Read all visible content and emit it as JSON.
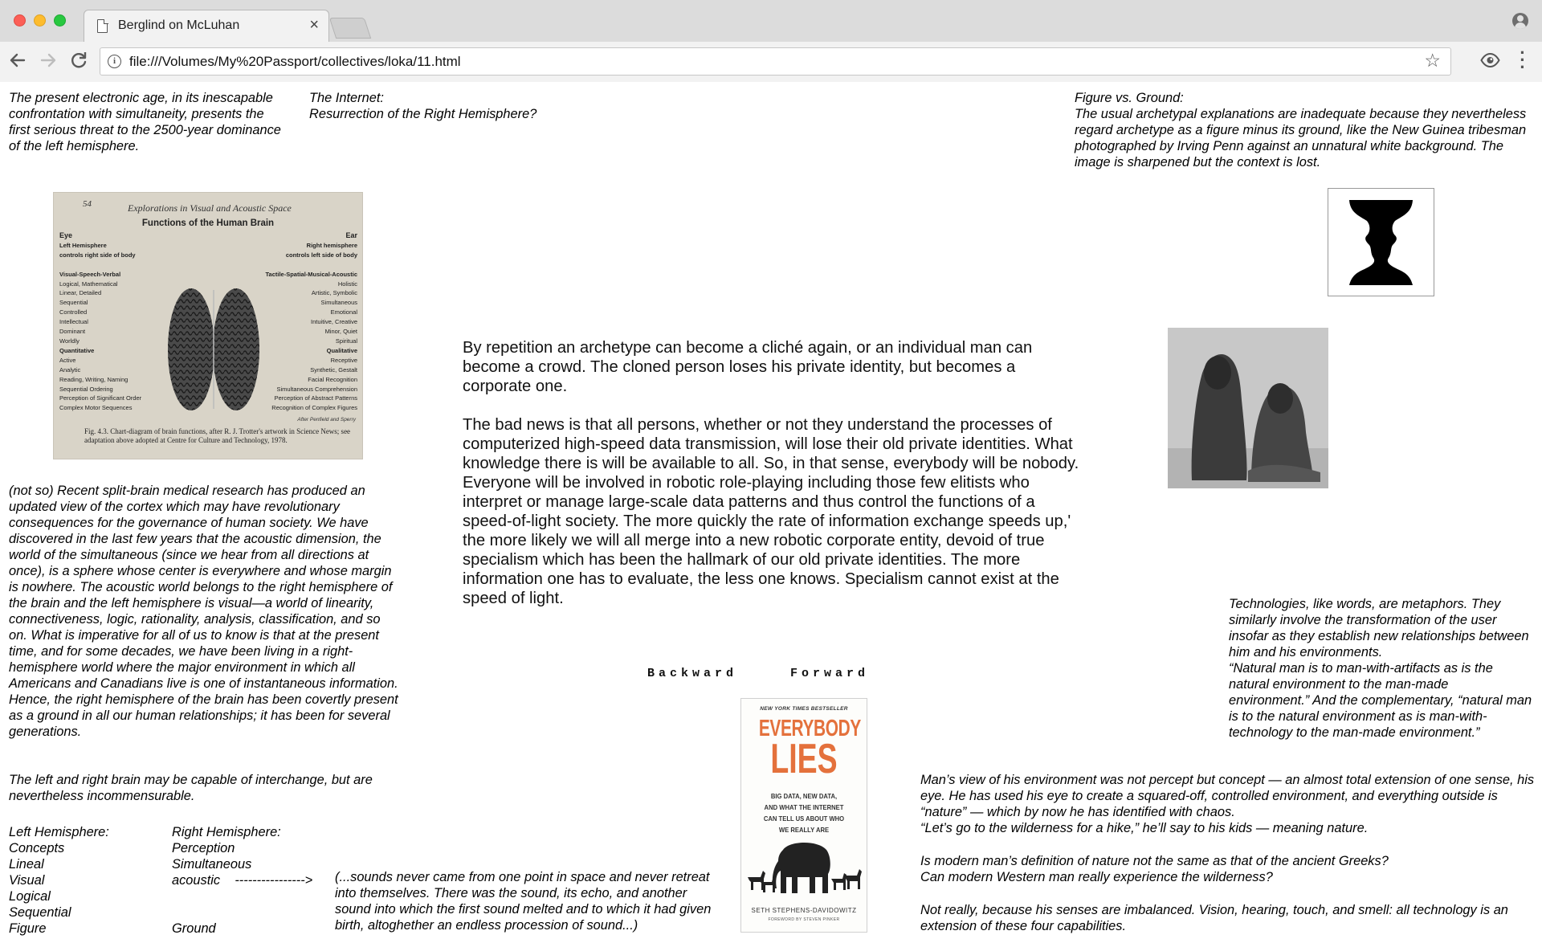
{
  "browser": {
    "tab_title": "Berglind on McLuhan",
    "tab_close": "×",
    "url": "file:///Volumes/My%20Passport/collectives/loka/11.html",
    "icons": [
      "page-icon",
      "close-icon",
      "profile-icon",
      "back-arrow-icon",
      "forward-arrow-icon",
      "reload-icon",
      "info-icon",
      "star-icon",
      "eye-icon",
      "menu-dots-icon"
    ]
  },
  "page": {
    "top_left_quote": "The present electronic age, in its inescapable confrontation with simultaneity, presents the first serious threat to the 2500-year dominance of the left hemisphere.",
    "top_center_title": "The Internet:\nResurrection of the Right Hemisphere?",
    "top_right_title": "Figure vs. Ground:",
    "top_right_text": "The usual archetypal explanations are inadequate because they nevertheless regard archetype as a figure minus its ground, like the New Guinea tribesman photographed by Irving Penn against an unnatural white background. The image is sharpened but the context is lost.",
    "brain_image": {
      "page_number": "54",
      "running_head": "Explorations in Visual and Acoustic Space",
      "title": "Functions of the Human Brain",
      "left_column": [
        "Eye",
        "Left Hemisphere",
        "controls right side of body",
        "",
        "Visual-Speech-Verbal",
        "Logical, Mathematical",
        "Linear, Detailed",
        "Sequential",
        "Controlled",
        "Intellectual",
        "Dominant",
        "Worldly",
        "Quantitative",
        "Active",
        "Analytic",
        "Reading, Writing, Naming",
        "Sequential Ordering",
        "Perception of Significant Order",
        "Complex Motor Sequences"
      ],
      "right_column": [
        "Ear",
        "Right hemisphere",
        "controls left side of body",
        "",
        "Tactile-Spatial-Musical-Acoustic",
        "Holistic",
        "Artistic, Symbolic",
        "Simultaneous",
        "Emotional",
        "Intuitive, Creative",
        "Minor, Quiet",
        "Spiritual",
        "Qualitative",
        "Receptive",
        "Synthetic, Gestalt",
        "Facial Recognition",
        "Simultaneous Comprehension",
        "Perception of Abstract Patterns",
        "Recognition of Complex Figures"
      ],
      "credit": "After Penfield and Sperry",
      "caption": "Fig. 4.3. Chart-diagram of brain functions, after R. J. Trotter's artwork in Science News; see adaptation above adopted at Centre for Culture and Technology, 1978."
    },
    "main_paragraph_1": "By repetition an archetype can become a cliché again, or an individual man can become a crowd. The cloned person loses his private identity, but becomes a corporate one.",
    "main_paragraph_2": "The bad news is that all persons, whether or not they understand the processes of computerized high-speed data transmission, will lose their old private identities. What knowledge there is will be available to all. So, in that sense, everybody will be nobody. Everyone will be involved in robotic role-playing including those few elitists who interpret or manage large-scale data patterns and thus control the functions of a speed-of-light society. The more quickly the rate of information exchange speeds up,' the more likely we will all merge into a new robotic corporate entity, devoid of true specialism which has been the hallmark of our old private identities. The more information one has to evaluate, the less one knows. Specialism cannot exist at the speed of light.",
    "split_brain_text": "(not so) Recent split-brain medical research has produced an updated view of the cortex which may have revolutionary consequences for the governance of human society. We have discovered in the last few years that the acoustic dimension, the world of the simultaneous (since we hear from all directions at once), is a sphere whose center is everywhere and whose margin is nowhere. The acoustic world belongs to the right hemisphere of the brain and the left hemisphere is visual—a world of linearity, connectiveness, logic, rationality, analysis, classification, and so on. What is imperative for all of us to know is that at the present time, and for some decades, we have been living in a right-hemisphere world where the major environment in which all Americans and Canadians live is one of instantaneous information. Hence, the right hemisphere of the brain has been covertly present as a ground in all our human relationships; it has been for several generations.",
    "interchange_text": "The left and right brain may be capable of interchange, but are nevertheless incommensurable.",
    "left_hemisphere_list": [
      "Left Hemisphere:",
      "Concepts",
      "Lineal",
      "Visual",
      "Logical",
      "Sequential",
      "Figure"
    ],
    "right_hemisphere_list": [
      "Right Hemisphere:",
      "Perception",
      "Simultaneous",
      "acoustic    ---------------->",
      "",
      "",
      "Ground"
    ],
    "sounds_quote": "(...sounds never came from one point in space and never retreat into themselves. There was the sound, its echo, and another sound into which the first sound melted and to which it had given birth, altoghether an endless procession of sound...)",
    "nav": {
      "backward": "Backward",
      "forward": "Forward"
    },
    "book": {
      "top_line": "NEW YORK TIMES BESTSELLER",
      "title_1": "EVERYBODY",
      "title_2": "LIES",
      "subtitle": [
        "BIG DATA, NEW DATA,",
        "AND WHAT THE INTERNET",
        "CAN TELL US ABOUT WHO",
        "WE REALLY ARE"
      ],
      "author": "SETH STEPHENS-DAVIDOWITZ",
      "foreword": "FOREWORD BY STEVEN PINKER"
    },
    "technologies_text": "Technologies, like words, are metaphors. They similarly involve the transformation of the user insofar as they establish new relationships between him and his environments.\n“Natural man is to man-with-artifacts as is the natural environment to the man-made environment.” And the complementary, “natural man is to the natural environment as is man-with-technology to the man-made environment.”",
    "mans_view_text": "Man’s view of his environment was not percept but concept — an almost total extension of one sense, his eye. He has used his eye to create a squared-off, controlled environment, and everything outside is “nature” — which by now he has identified with chaos.\n“Let’s go to the wilderness for a hike,” he’ll say to his kids — meaning nature.",
    "question_text": "Is modern man’s definition of nature not the same as that of the ancient Greeks?\nCan modern Western man really experience the wilderness?",
    "senses_text": "Not really, because his senses are imbalanced. Vision, hearing, touch, and smell: all technology is an extension of these four capabilities."
  }
}
